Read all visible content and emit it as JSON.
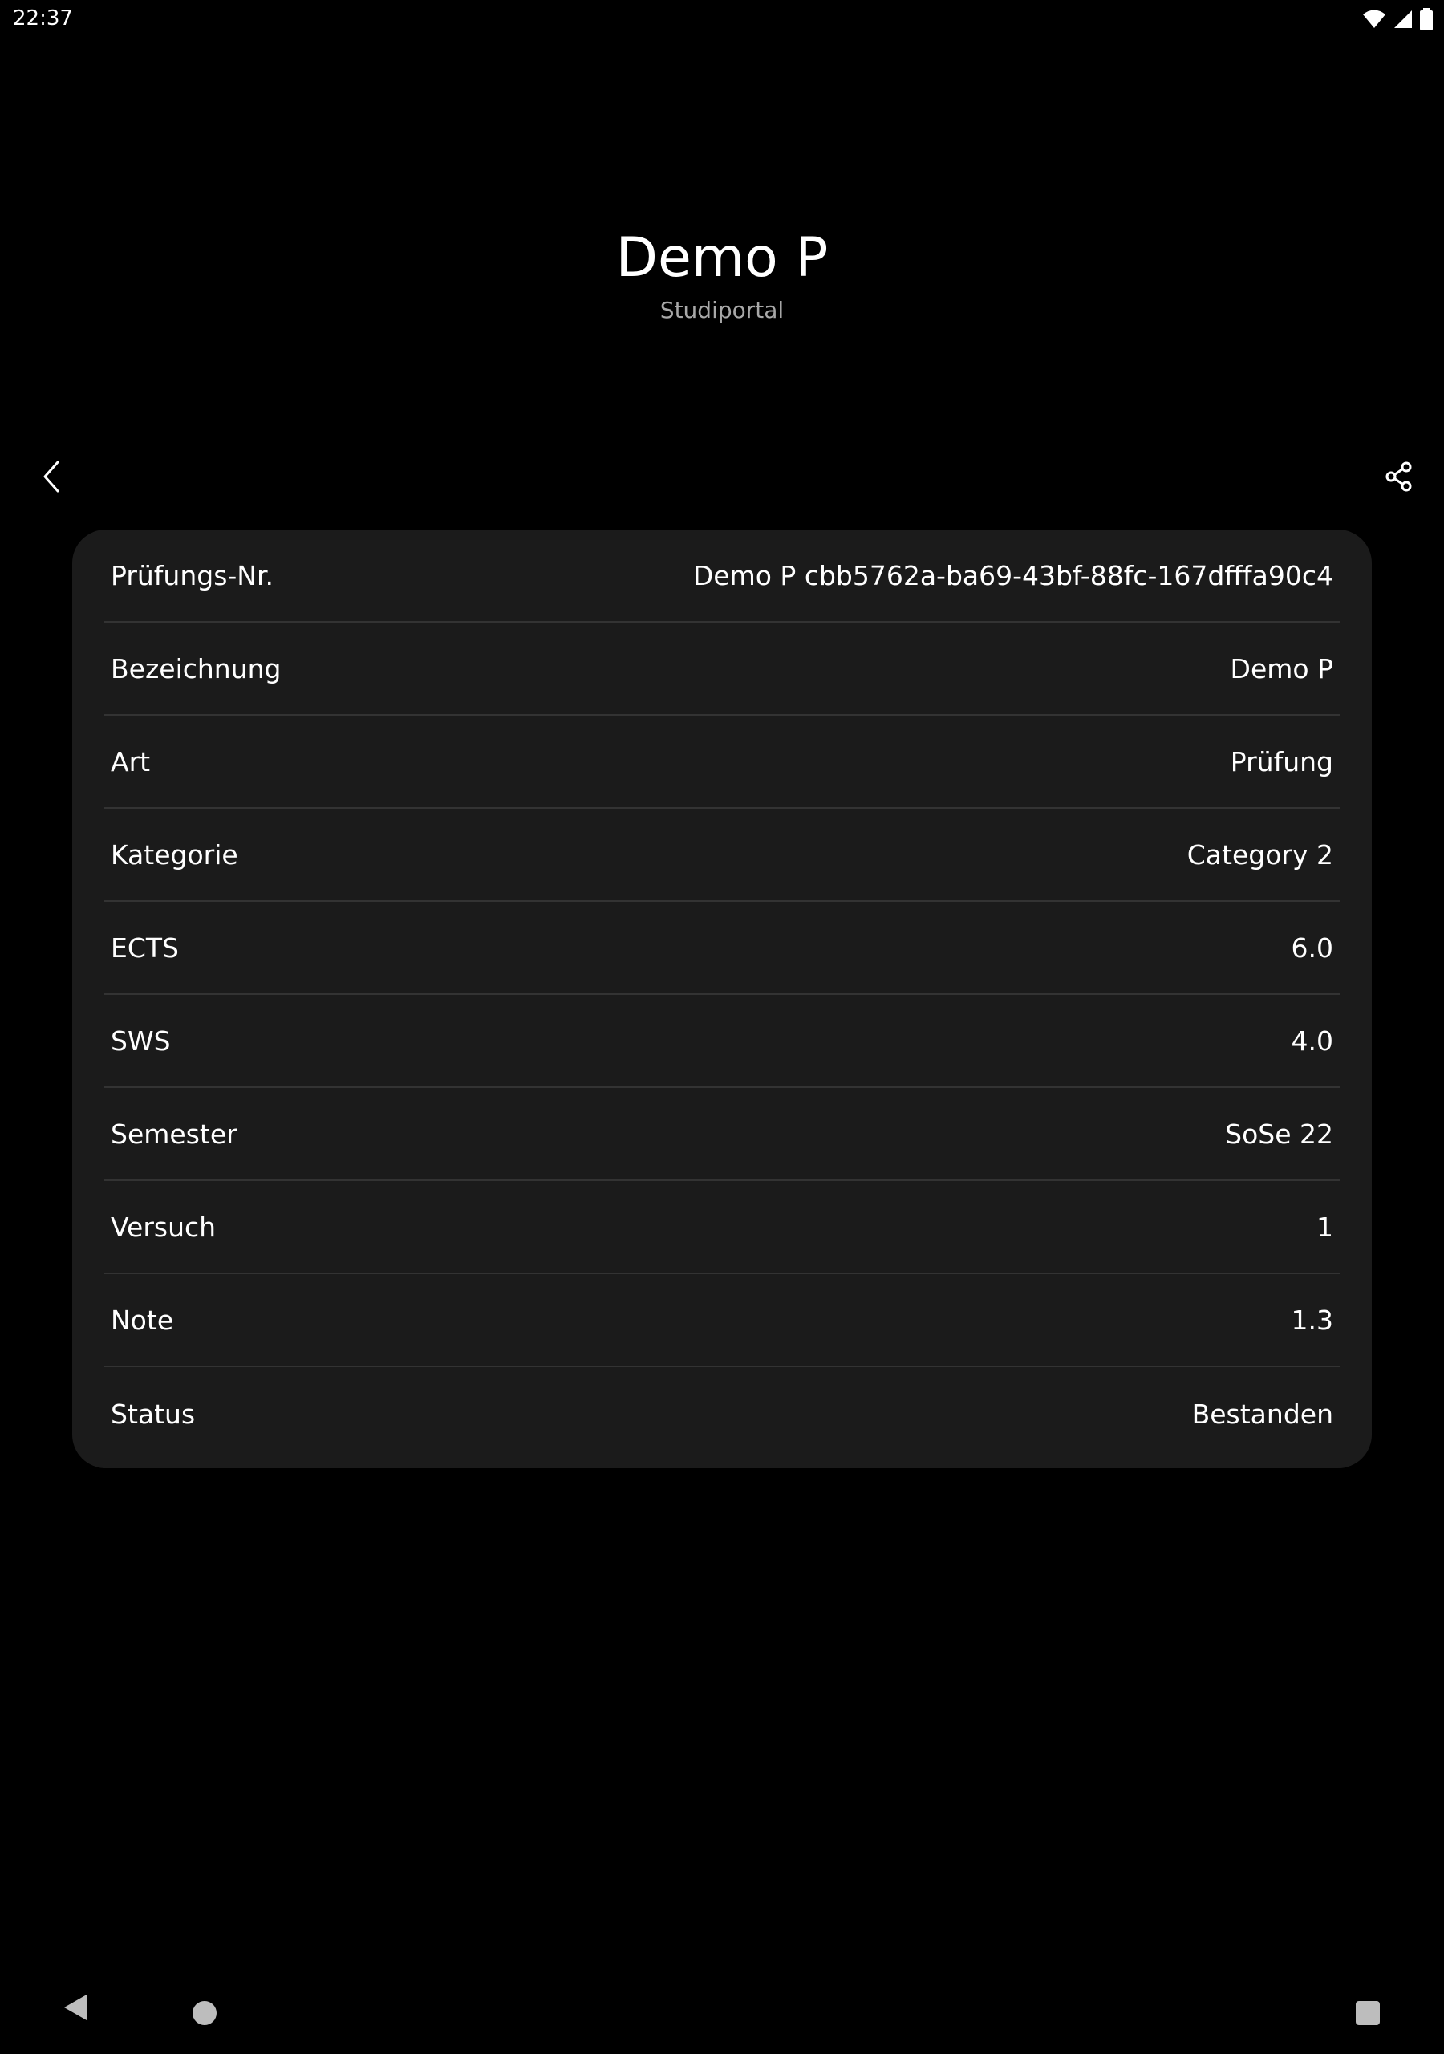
{
  "status_bar": {
    "time": "22:37",
    "icons": [
      "wifi-icon",
      "cell-signal-icon",
      "battery-icon"
    ]
  },
  "header": {
    "title": "Demo P",
    "subtitle": "Studiportal"
  },
  "toolbar": {
    "back_icon": "chevron-left-icon",
    "share_icon": "share-icon"
  },
  "details": {
    "rows": [
      {
        "label": "Prüfungs-Nr.",
        "value": "Demo P cbb5762a-ba69-43bf-88fc-167dfffa90c4"
      },
      {
        "label": "Bezeichnung",
        "value": "Demo P"
      },
      {
        "label": "Art",
        "value": "Prüfung"
      },
      {
        "label": "Kategorie",
        "value": "Category 2"
      },
      {
        "label": "ECTS",
        "value": "6.0"
      },
      {
        "label": "SWS",
        "value": "4.0"
      },
      {
        "label": "Semester",
        "value": "SoSe 22"
      },
      {
        "label": "Versuch",
        "value": "1"
      },
      {
        "label": "Note",
        "value": "1.3"
      },
      {
        "label": "Status",
        "value": "Bestanden"
      }
    ]
  },
  "navbar": {
    "icons": [
      "nav-back-icon",
      "nav-home-icon",
      "nav-recents-icon"
    ]
  },
  "colors": {
    "background": "#000000",
    "card": "#1b1b1b",
    "divider": "#333333",
    "text": "#ffffff",
    "subtitle": "#a8a8a8"
  }
}
